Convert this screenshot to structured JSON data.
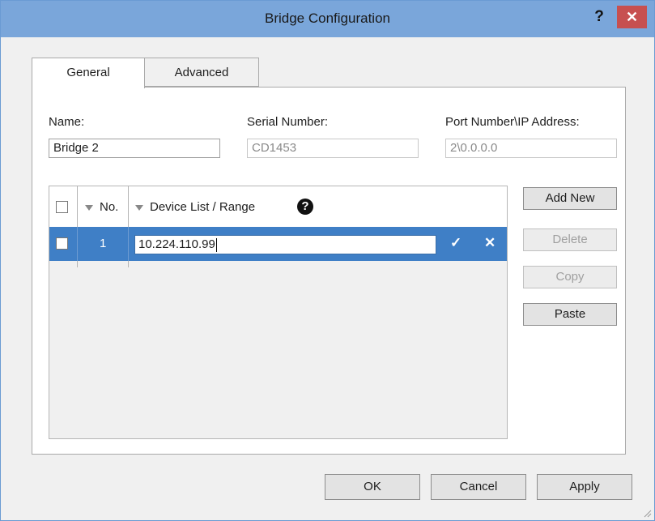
{
  "window": {
    "title": "Bridge Configuration",
    "help_label": "?",
    "close_label": "✕"
  },
  "tabs": [
    {
      "label": "General",
      "selected": true
    },
    {
      "label": "Advanced",
      "selected": false
    }
  ],
  "fields": {
    "name_label": "Name:",
    "name_value": "Bridge 2",
    "serial_label": "Serial Number:",
    "serial_value": "CD1453",
    "port_label": "Port Number\\IP Address:",
    "port_value": "2\\0.0.0.0"
  },
  "grid": {
    "col_no": "No.",
    "col_device": "Device List / Range",
    "help_icon": "?",
    "rows": [
      {
        "no": "1",
        "device": "10.224.110.99",
        "editing": true
      }
    ],
    "confirm_icon": "✓",
    "cancel_icon": "✕"
  },
  "side_buttons": {
    "add_new": "Add New",
    "delete": "Delete",
    "copy": "Copy",
    "paste": "Paste"
  },
  "footer_buttons": {
    "ok": "OK",
    "cancel": "Cancel",
    "apply": "Apply"
  },
  "colors": {
    "titlebar": "#7aa6da",
    "close": "#c75050",
    "selected_row": "#3f7fc6"
  }
}
